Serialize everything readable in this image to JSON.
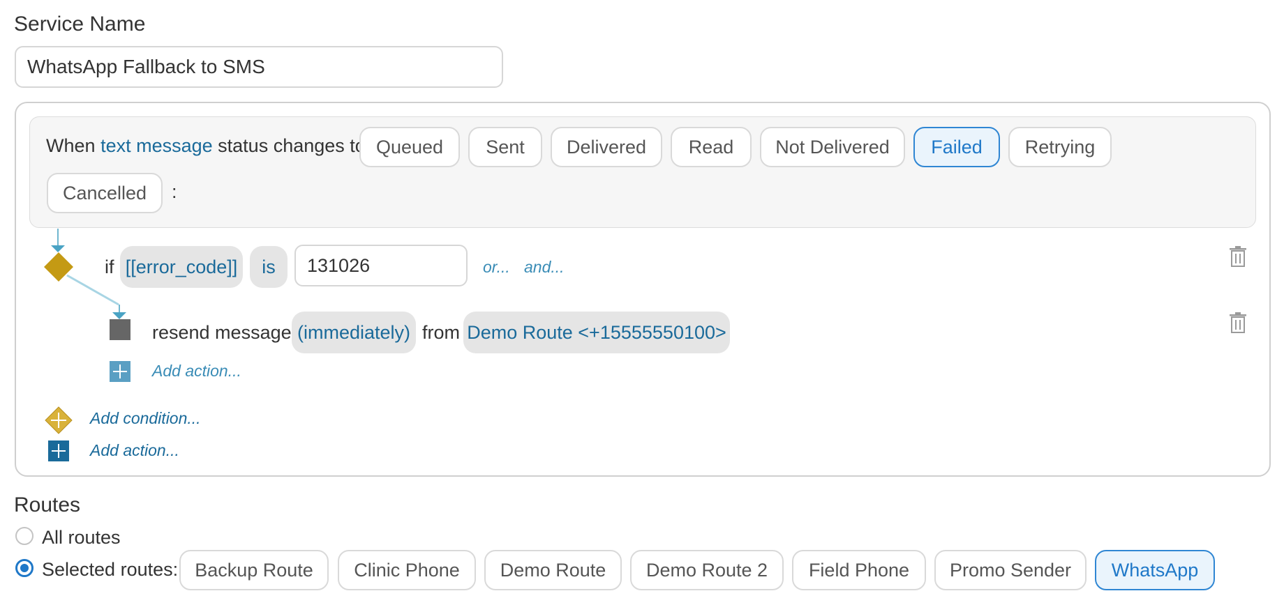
{
  "service": {
    "label": "Service Name",
    "value": "WhatsApp Fallback to SMS"
  },
  "trigger": {
    "when": "When",
    "subject": "text message",
    "status_text": "status changes to",
    "colon": ":",
    "statuses": [
      {
        "label": "Queued",
        "selected": false
      },
      {
        "label": "Sent",
        "selected": false
      },
      {
        "label": "Delivered",
        "selected": false
      },
      {
        "label": "Read",
        "selected": false
      },
      {
        "label": "Not Delivered",
        "selected": false
      },
      {
        "label": "Failed",
        "selected": true
      },
      {
        "label": "Retrying",
        "selected": false
      },
      {
        "label": "Cancelled",
        "selected": false
      }
    ]
  },
  "condition": {
    "if": "if",
    "field": "[[error_code]]",
    "operator": "is",
    "value": "131026",
    "or": "or...",
    "and": "and..."
  },
  "action": {
    "verb": "resend message",
    "timing": "(immediately)",
    "from": "from",
    "route": "Demo Route <+15555550100>",
    "add_inner": "Add action..."
  },
  "add_condition": "Add condition...",
  "add_action": "Add action...",
  "routes": {
    "label": "Routes",
    "all": "All routes",
    "selected": "Selected routes:",
    "mode": "selected",
    "items": [
      {
        "label": "Backup Route",
        "selected": false
      },
      {
        "label": "Clinic Phone",
        "selected": false
      },
      {
        "label": "Demo Route",
        "selected": false
      },
      {
        "label": "Demo Route 2",
        "selected": false
      },
      {
        "label": "Field Phone",
        "selected": false
      },
      {
        "label": "Promo Sender",
        "selected": false
      },
      {
        "label": "WhatsApp",
        "selected": true
      }
    ]
  },
  "colors": {
    "accent": "#1f78c8",
    "link": "#1a6a9a",
    "condition_diamond": "#c49a14",
    "action_square": "#666666",
    "connector": "#6fb6cf"
  },
  "icons": [
    "trash-icon",
    "diamond-icon",
    "square-icon",
    "plus-icon",
    "radio-icon"
  ]
}
